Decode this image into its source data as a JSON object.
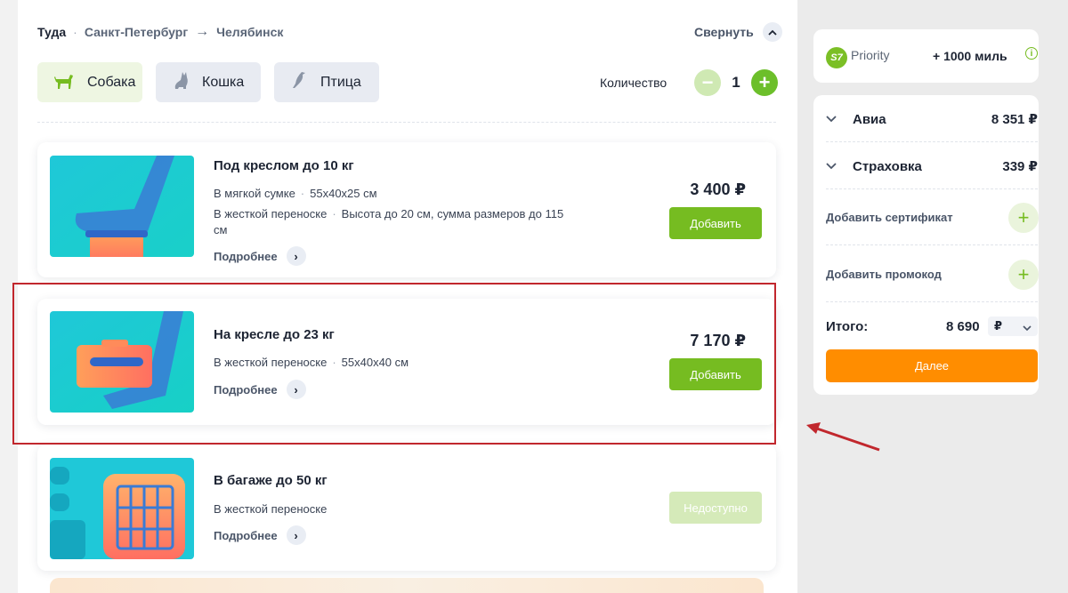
{
  "header": {
    "direction": "Туда",
    "separator": "·",
    "from": "Санкт-Петербург",
    "arrow": "→",
    "to": "Челябинск",
    "collapse_label": "Свернуть"
  },
  "tabs": [
    {
      "label": "Собака",
      "icon": "dog-icon",
      "active": true
    },
    {
      "label": "Кошка",
      "icon": "cat-icon",
      "active": false
    },
    {
      "label": "Птица",
      "icon": "bird-icon",
      "active": false
    }
  ],
  "quantity": {
    "label": "Количество",
    "value": "1",
    "minus": "−",
    "plus": "+"
  },
  "cards": [
    {
      "title": "Под креслом до 10 кг",
      "line1a": "В мягкой сумке",
      "line1b": "55x40x25 см",
      "line2a": "В жесткой переноске",
      "line2b": "Высота до 20 см, сумма размеров до 115 см",
      "more": "Подробнее",
      "price": "3 400 ₽",
      "button": "Добавить"
    },
    {
      "title": "На кресле до 23 кг",
      "line1a": "В жесткой переноске",
      "line1b": "55x40x40 см",
      "more": "Подробнее",
      "price": "7 170 ₽",
      "button": "Добавить"
    },
    {
      "title": "В багаже до 50 кг",
      "line1a": "В жесткой переноске",
      "more": "Подробнее",
      "button": "Недоступно"
    }
  ],
  "side": {
    "priority": {
      "logo": "S7",
      "name": "Priority",
      "miles": "+ 1000 миль",
      "info": "i"
    },
    "summary": {
      "avia_label": "Авиа",
      "avia_amount": "8 351 ₽",
      "insurance_label": "Страховка",
      "insurance_amount": "339 ₽",
      "add_certificate": "Добавить сертификат",
      "add_promo": "Добавить промокод",
      "total_label": "Итого:",
      "total_value": "8 690",
      "currency": "₽",
      "next_button": "Далее"
    }
  },
  "colors": {
    "accent_green": "#76bc21",
    "orange": "#ff8d00",
    "highlight_red": "#c1272d",
    "teal": "#1fc8d8"
  }
}
